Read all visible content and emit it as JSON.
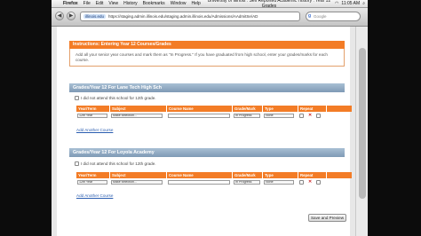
{
  "menubar": {
    "app": "Firefox",
    "items": [
      "File",
      "Edit",
      "View",
      "History",
      "Bookmarks",
      "Window",
      "Help"
    ],
    "window_title": "University of Illinois : Self Reported Academic History : Year 12 Grades",
    "clock": "11:05 AM"
  },
  "toolbar": {
    "url_host": "illinois.edu",
    "url": "https://staging.admin.illinois.edu/staging.admin.illinois.edu/Admissions/AAdmitSe/AD",
    "search_placeholder": "Google"
  },
  "instructions": {
    "title": "Instructions: Entering Year 12 Courses/Grades",
    "body": "Add all your senior year courses and mark them as \"In Progress.\" If you have graduated from high school, enter your grades/marks for each course."
  },
  "columns": [
    "Year/Term",
    "Subject",
    "Course Name",
    "Grade/Mark",
    "Type",
    "Repeat"
  ],
  "schools": [
    {
      "title": "Grades/Year 12 For Lane Tech High Sch",
      "no_attend": "I did not attend this school for 12th grade.",
      "row": {
        "term": "12th Year",
        "subject": "Make selection...",
        "course": "",
        "grade": "In Progress",
        "type": "None"
      },
      "add_link": "Add Another Course"
    },
    {
      "title": "Grades/Year 12 For Loyola Academy",
      "no_attend": "I did not attend this school for 12th grade.",
      "row": {
        "term": "12th Year",
        "subject": "Make selection...",
        "course": "",
        "grade": "In Progress",
        "type": "None"
      },
      "add_link": "Add Another Course"
    }
  ],
  "save_button": "Save and Preview"
}
